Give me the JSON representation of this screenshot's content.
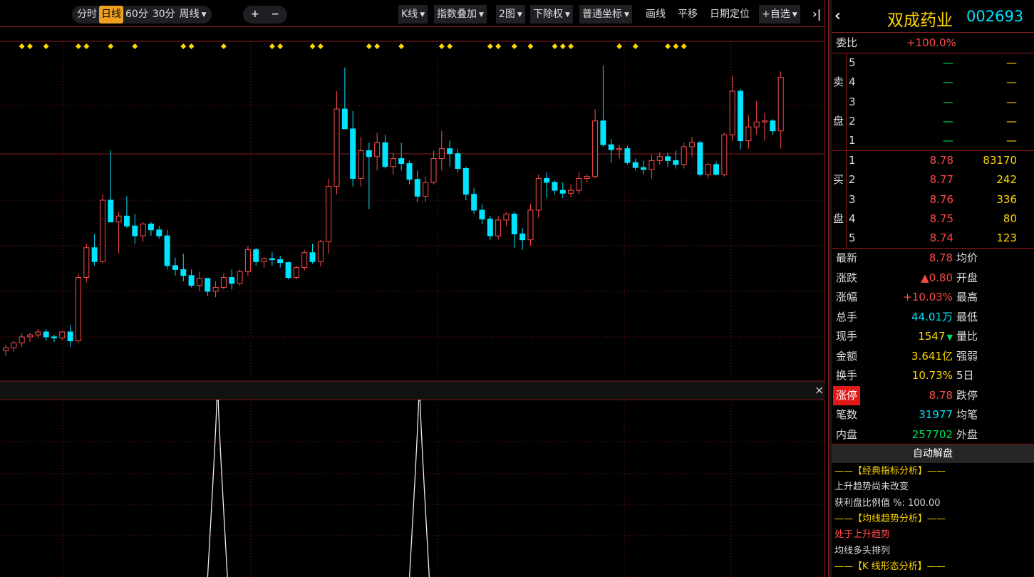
{
  "toolbar": {
    "periods": [
      "分时",
      "日线",
      "60分",
      "30分",
      "周线"
    ],
    "active_period": "日线",
    "zoom_in": "+",
    "zoom_out": "−",
    "kline": "K线",
    "index_overlay": "指数叠加",
    "two_chart": "2图",
    "adjust": "下除权",
    "coord": "普通坐标",
    "draw": "画线",
    "pan": "平移",
    "date_locate": "日期定位",
    "add_fav": "+自选",
    "collapse": "›|"
  },
  "colors": {
    "up": "#ff4d4d",
    "down": "#00e4ff",
    "marker": "#ffd700",
    "grid": "#8b1a1a",
    "active": "#f0a020"
  },
  "chart_data": {
    "type": "candlestick",
    "candles": [
      [
        7.02,
        7.08,
        6.97,
        7.05
      ],
      [
        7.05,
        7.12,
        7.01,
        7.1
      ],
      [
        7.1,
        7.2,
        7.06,
        7.16
      ],
      [
        7.16,
        7.2,
        7.11,
        7.18
      ],
      [
        7.18,
        7.24,
        7.15,
        7.21
      ],
      [
        7.21,
        7.24,
        7.12,
        7.16
      ],
      [
        7.16,
        7.18,
        7.11,
        7.15
      ],
      [
        7.15,
        7.22,
        7.13,
        7.21
      ],
      [
        7.21,
        7.28,
        7.06,
        7.12
      ],
      [
        7.12,
        7.8,
        7.1,
        7.76
      ],
      [
        7.76,
        8.1,
        7.71,
        8.06
      ],
      [
        8.06,
        8.2,
        7.88,
        7.92
      ],
      [
        7.92,
        8.6,
        7.9,
        8.54
      ],
      [
        8.54,
        9.04,
        8.45,
        8.32
      ],
      [
        8.32,
        8.42,
        8.0,
        8.38
      ],
      [
        8.38,
        8.58,
        8.26,
        8.28
      ],
      [
        8.28,
        8.4,
        8.1,
        8.18
      ],
      [
        8.18,
        8.32,
        8.12,
        8.3
      ],
      [
        8.3,
        8.32,
        8.18,
        8.24
      ],
      [
        8.24,
        8.28,
        8.15,
        8.18
      ],
      [
        8.18,
        8.24,
        7.84,
        7.88
      ],
      [
        7.88,
        7.96,
        7.78,
        7.84
      ],
      [
        7.84,
        8.0,
        7.72,
        7.78
      ],
      [
        7.78,
        7.84,
        7.66,
        7.68
      ],
      [
        7.68,
        7.82,
        7.62,
        7.75
      ],
      [
        7.75,
        7.74,
        7.57,
        7.62
      ],
      [
        7.62,
        7.72,
        7.56,
        7.66
      ],
      [
        7.66,
        7.8,
        7.64,
        7.76
      ],
      [
        7.76,
        7.84,
        7.64,
        7.7
      ],
      [
        7.7,
        7.84,
        7.68,
        7.82
      ],
      [
        7.82,
        8.08,
        7.78,
        8.04
      ],
      [
        8.04,
        8.06,
        7.88,
        7.92
      ],
      [
        7.92,
        7.96,
        7.86,
        7.95
      ],
      [
        7.95,
        8.02,
        7.88,
        7.94
      ],
      [
        7.94,
        7.98,
        7.86,
        7.91
      ],
      [
        7.91,
        7.92,
        7.74,
        7.76
      ],
      [
        7.76,
        7.88,
        7.74,
        7.86
      ],
      [
        7.86,
        8.04,
        7.83,
        8.01
      ],
      [
        8.01,
        8.1,
        7.9,
        7.92
      ],
      [
        7.92,
        8.14,
        7.87,
        8.12
      ],
      [
        8.12,
        8.76,
        8.0,
        8.68
      ],
      [
        8.68,
        9.64,
        8.6,
        9.46
      ],
      [
        9.46,
        9.88,
        9.3,
        9.26
      ],
      [
        9.26,
        9.44,
        8.68,
        8.76
      ],
      [
        8.76,
        9.18,
        8.68,
        9.04
      ],
      [
        9.04,
        9.12,
        8.45,
        8.98
      ],
      [
        8.98,
        9.22,
        8.84,
        9.12
      ],
      [
        9.12,
        9.2,
        8.86,
        8.88
      ],
      [
        8.88,
        9.02,
        8.8,
        8.96
      ],
      [
        8.96,
        9.12,
        8.84,
        8.91
      ],
      [
        8.91,
        8.94,
        8.7,
        8.75
      ],
      [
        8.75,
        8.84,
        8.52,
        8.58
      ],
      [
        8.58,
        8.78,
        8.52,
        8.72
      ],
      [
        8.72,
        9.04,
        8.7,
        8.96
      ],
      [
        8.96,
        9.24,
        8.84,
        9.06
      ],
      [
        9.06,
        9.14,
        8.88,
        9.01
      ],
      [
        9.01,
        9.06,
        8.82,
        8.86
      ],
      [
        8.86,
        8.88,
        8.54,
        8.6
      ],
      [
        8.6,
        8.66,
        8.4,
        8.44
      ],
      [
        8.44,
        8.5,
        8.3,
        8.35
      ],
      [
        8.35,
        8.38,
        8.14,
        8.18
      ],
      [
        8.18,
        8.38,
        8.14,
        8.34
      ],
      [
        8.34,
        8.42,
        8.28,
        8.4
      ],
      [
        8.4,
        8.42,
        8.06,
        8.2
      ],
      [
        8.2,
        8.26,
        8.04,
        8.14
      ],
      [
        8.14,
        8.5,
        8.08,
        8.44
      ],
      [
        8.44,
        8.8,
        8.36,
        8.76
      ],
      [
        8.76,
        8.82,
        8.56,
        8.72
      ],
      [
        8.72,
        8.74,
        8.6,
        8.64
      ],
      [
        8.64,
        8.72,
        8.56,
        8.61
      ],
      [
        8.61,
        8.7,
        8.57,
        8.64
      ],
      [
        8.64,
        8.82,
        8.6,
        8.76
      ],
      [
        8.76,
        8.8,
        8.72,
        8.78
      ],
      [
        8.78,
        9.46,
        8.76,
        9.34
      ],
      [
        9.34,
        9.9,
        9.08,
        9.1
      ],
      [
        9.1,
        9.16,
        8.92,
        9.05
      ],
      [
        9.05,
        9.1,
        8.96,
        9.06
      ],
      [
        9.06,
        9.09,
        8.9,
        8.92
      ],
      [
        8.92,
        8.96,
        8.84,
        8.87
      ],
      [
        8.87,
        8.94,
        8.8,
        8.85
      ],
      [
        8.85,
        9.0,
        8.76,
        8.94
      ],
      [
        8.94,
        9.02,
        8.9,
        8.98
      ],
      [
        8.98,
        9.02,
        8.88,
        8.94
      ],
      [
        8.94,
        9.04,
        8.86,
        8.9
      ],
      [
        8.9,
        9.12,
        8.86,
        9.08
      ],
      [
        9.08,
        9.18,
        8.98,
        9.12
      ],
      [
        9.12,
        9.14,
        8.78,
        8.8
      ],
      [
        8.8,
        8.92,
        8.76,
        8.9
      ],
      [
        8.9,
        8.93,
        8.79,
        8.8
      ],
      [
        8.8,
        9.22,
        8.78,
        9.2
      ],
      [
        9.2,
        9.8,
        9.14,
        9.64
      ],
      [
        9.64,
        9.66,
        9.05,
        9.14
      ],
      [
        9.14,
        9.4,
        9.06,
        9.28
      ],
      [
        9.28,
        9.54,
        9.2,
        9.33
      ],
      [
        9.33,
        9.42,
        9.14,
        9.34
      ],
      [
        9.34,
        9.36,
        9.2,
        9.24
      ],
      [
        9.24,
        9.84,
        9.06,
        9.78
      ]
    ],
    "diamond_markers": [
      2,
      3,
      5,
      9,
      10,
      13,
      16,
      22,
      23,
      27,
      33,
      34,
      38,
      39,
      45,
      46,
      49,
      54,
      55,
      60,
      61,
      63,
      65,
      68,
      69,
      70,
      76,
      78,
      82,
      83,
      84
    ]
  },
  "indicator_panel": {
    "close_label": "×",
    "peaks": [
      25,
      50
    ]
  },
  "quote": {
    "name": "双成药业",
    "code": "002693",
    "weibi_label": "委比",
    "weibi_value": "+100.0%",
    "sell_label": [
      "卖",
      "盘"
    ],
    "buy_label": [
      "买",
      "盘"
    ],
    "sell": [
      {
        "n": "5",
        "price": "—",
        "vol": "—"
      },
      {
        "n": "4",
        "price": "—",
        "vol": "—"
      },
      {
        "n": "3",
        "price": "—",
        "vol": "—"
      },
      {
        "n": "2",
        "price": "—",
        "vol": "—"
      },
      {
        "n": "1",
        "price": "—",
        "vol": "—"
      }
    ],
    "buy": [
      {
        "n": "1",
        "price": "8.78",
        "vol": "83170"
      },
      {
        "n": "2",
        "price": "8.77",
        "vol": "242"
      },
      {
        "n": "3",
        "price": "8.76",
        "vol": "336"
      },
      {
        "n": "4",
        "price": "8.75",
        "vol": "80"
      },
      {
        "n": "5",
        "price": "8.74",
        "vol": "123"
      }
    ],
    "stats": [
      {
        "l": "最新",
        "v": "8.78",
        "c": "red",
        "r": "均价"
      },
      {
        "l": "涨跌",
        "v": "▲0.80",
        "c": "red",
        "r": "开盘"
      },
      {
        "l": "涨幅",
        "v": "+10.03%",
        "c": "red",
        "r": "最高"
      },
      {
        "l": "总手",
        "v": "44.01万",
        "c": "cyan",
        "r": "最低"
      },
      {
        "l": "现手",
        "v": "1547",
        "c": "yel",
        "r": "量比",
        "arrow": "▼"
      },
      {
        "l": "金额",
        "v": "3.641亿",
        "c": "yel",
        "r": "强弱"
      },
      {
        "l": "换手",
        "v": "10.73%",
        "c": "yel",
        "r": "5日"
      },
      {
        "l": "涨停",
        "v": "8.78",
        "c": "red",
        "r": "跌停",
        "hl": true
      },
      {
        "l": "笔数",
        "v": "31977",
        "c": "cyan",
        "r": "均笔"
      },
      {
        "l": "内盘",
        "v": "257702",
        "c": "grn",
        "r": "外盘"
      }
    ],
    "auto_button": "自动解盘",
    "analysis": [
      {
        "t": "——【经典指标分析】——",
        "c": "yel"
      },
      {
        "t": "上升趋势尚未改变",
        "c": "wht"
      },
      {
        "t": "获利盘比例值 %: 100.00",
        "c": "wht"
      },
      {
        "t": "——【均线趋势分析】——",
        "c": "yel"
      },
      {
        "t": "处于上升趋势",
        "c": "red"
      },
      {
        "t": "均线多头排列",
        "c": "wht"
      },
      {
        "t": "——【K 线形态分析】——",
        "c": "yel"
      }
    ]
  }
}
